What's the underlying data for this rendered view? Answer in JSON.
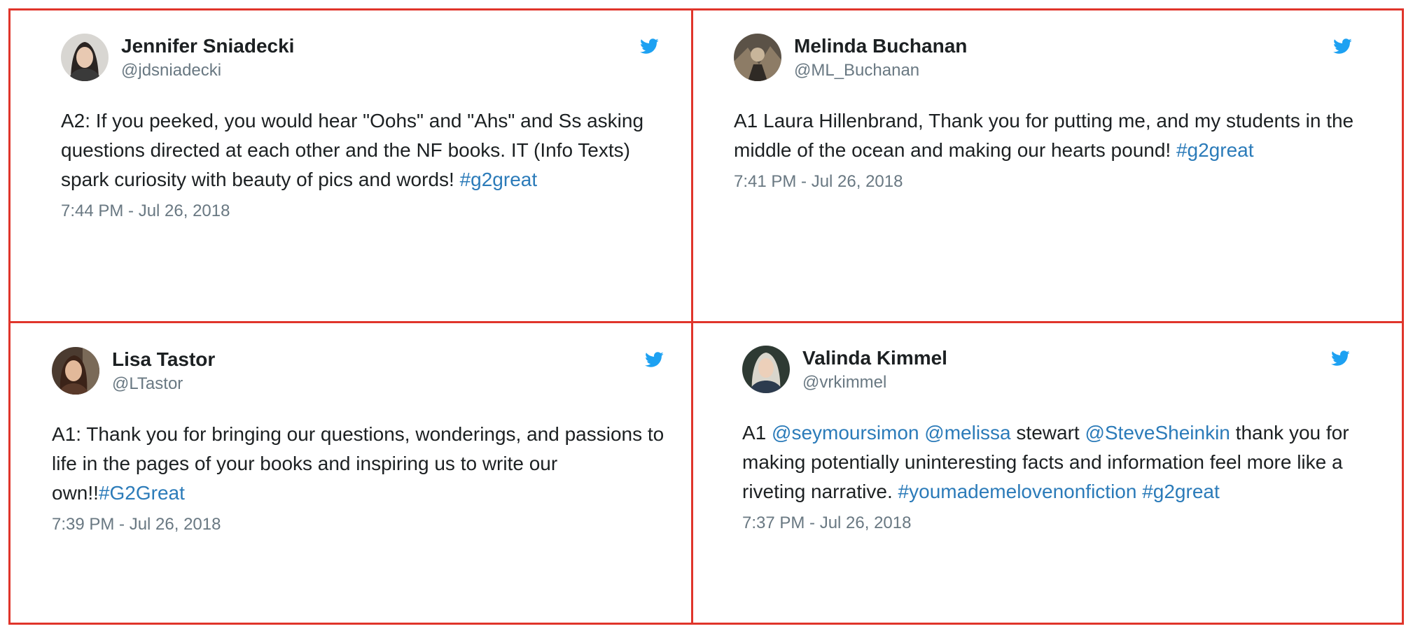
{
  "colors": {
    "border": "#e0352b",
    "link": "#2b7bb9",
    "muted": "#697882",
    "text": "#1c2022",
    "bird": "#1da1f2"
  },
  "tweets": [
    {
      "name": "Jennifer Sniadecki",
      "handle": "@jdsniadecki",
      "icon": "twitter-bird-icon",
      "text": [
        {
          "t": "A2: If you peeked, you would hear \"Oohs\" and \"Ahs\" and Ss asking questions directed at each other and the NF books. IT (Info Texts) spark curiosity with beauty of pics and words! "
        },
        {
          "t": "#g2great",
          "link": true
        }
      ],
      "time": "7:44 PM - Jul 26, 2018"
    },
    {
      "name": "Melinda Buchanan",
      "handle": "@ML_Buchanan",
      "icon": "twitter-bird-icon",
      "text": [
        {
          "t": "A1 Laura Hillenbrand, Thank you for putting me, and my students in the middle of the ocean and making our hearts pound! "
        },
        {
          "t": "#g2great",
          "link": true
        }
      ],
      "time": "7:41 PM - Jul 26, 2018"
    },
    {
      "name": "Lisa Tastor",
      "handle": "@LTastor",
      "icon": "twitter-bird-icon",
      "text": [
        {
          "t": "A1: Thank you for bringing our questions, wonderings, and passions to life in the pages of your books and inspiring us to write our own!!"
        },
        {
          "t": "#G2Great",
          "link": true
        }
      ],
      "time": "7:39 PM - Jul 26, 2018"
    },
    {
      "name": "Valinda Kimmel",
      "handle": "@vrkimmel",
      "icon": "twitter-bird-icon",
      "text": [
        {
          "t": "A1 "
        },
        {
          "t": "@seymoursimon",
          "link": true
        },
        {
          "t": " "
        },
        {
          "t": "@melissa",
          "link": true
        },
        {
          "t": " stewart "
        },
        {
          "t": "@SteveSheinkin",
          "link": true
        },
        {
          "t": " thank you for making potentially uninteresting facts and information feel more like a riveting narrative. "
        },
        {
          "t": "#youmademelovenonfiction",
          "link": true
        },
        {
          "t": " "
        },
        {
          "t": "#g2great",
          "link": true
        }
      ],
      "time": "7:37 PM - Jul 26, 2018"
    }
  ]
}
